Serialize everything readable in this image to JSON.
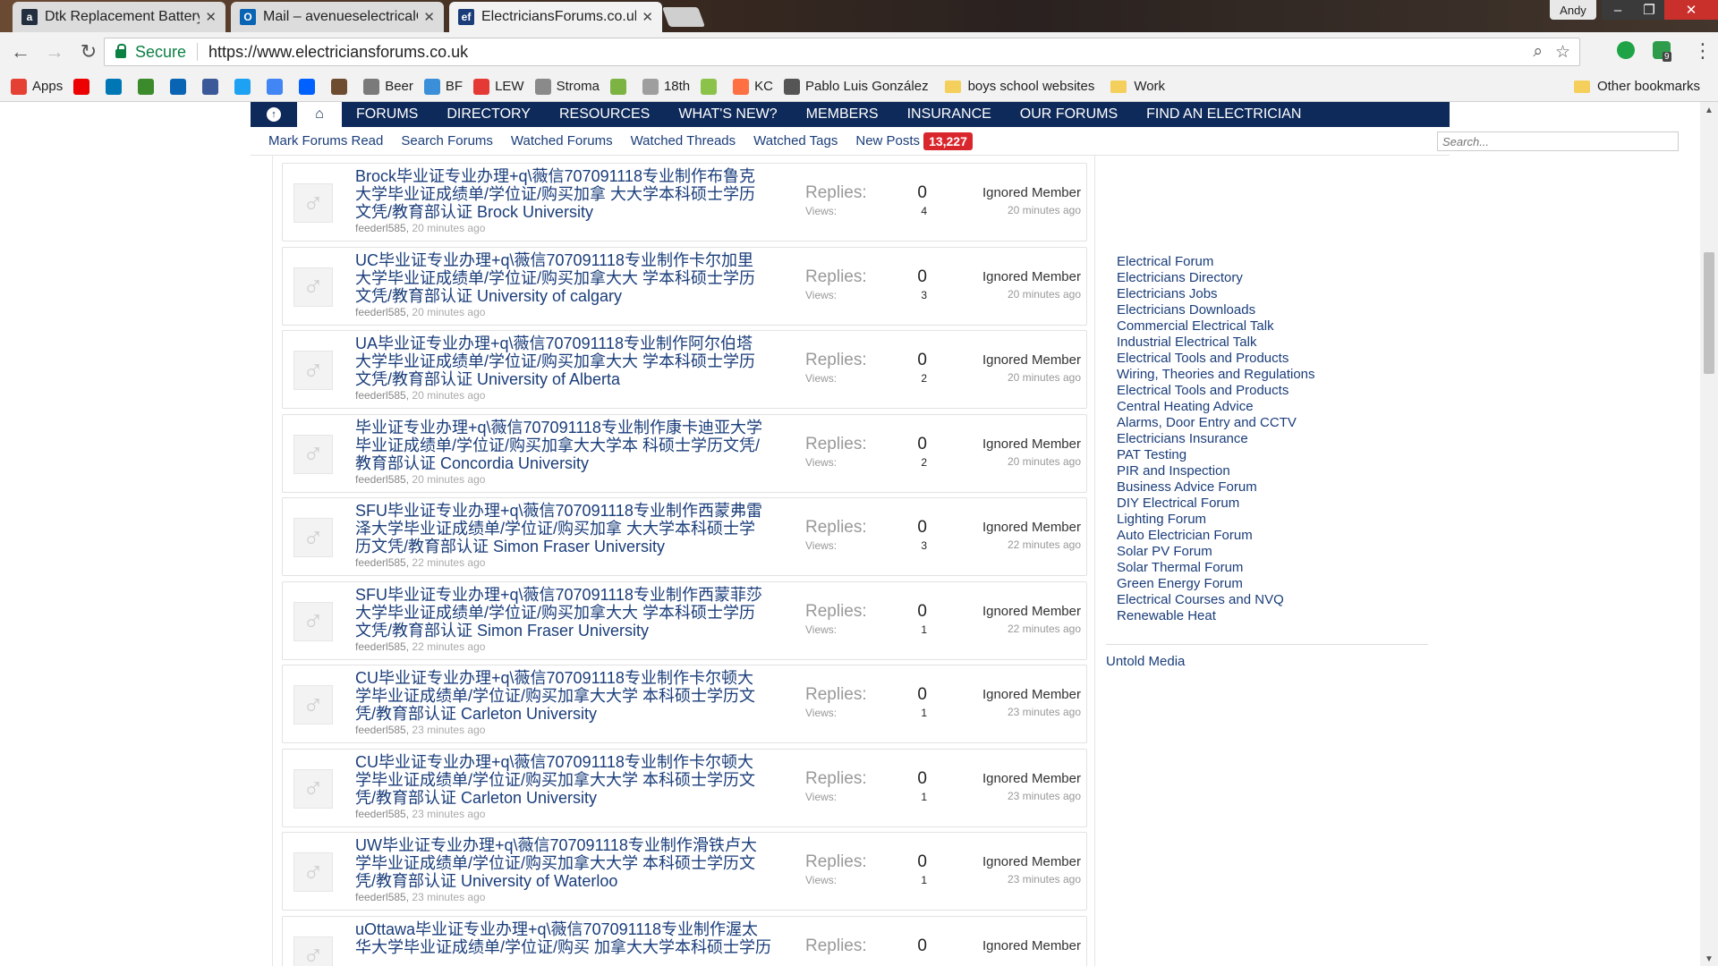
{
  "browser": {
    "tabs": [
      {
        "title": "Dtk Replacement Battery",
        "favicon": "a",
        "favicon_color": "#232f3e"
      },
      {
        "title": "Mail – avenueselectricalC",
        "favicon": "O",
        "favicon_color": "#0a64b4"
      },
      {
        "title": "ElectriciansForums.co.uk",
        "favicon": "ef",
        "favicon_color": "#1a3d7a"
      }
    ],
    "profile_name": "Andy",
    "secure_label": "Secure",
    "url": "https://www.electriciansforums.co.uk",
    "extension_badge": "9",
    "bookmarks": [
      {
        "label": "Apps",
        "icon": "apps-grid-icon",
        "color": "#e44134"
      },
      {
        "label": "",
        "icon": "santander-icon",
        "color": "#ec0000"
      },
      {
        "label": "",
        "icon": "linkedin-icon",
        "color": "#0077b5"
      },
      {
        "label": "",
        "icon": "fh-icon",
        "color": "#3b8b2c"
      },
      {
        "label": "",
        "icon": "outlook-icon",
        "color": "#0a64b4"
      },
      {
        "label": "",
        "icon": "facebook-icon",
        "color": "#3b5998"
      },
      {
        "label": "",
        "icon": "twitter-icon",
        "color": "#1da1f2"
      },
      {
        "label": "",
        "icon": "google-icon",
        "color": "#4285f4"
      },
      {
        "label": "",
        "icon": "dropbox-icon",
        "color": "#0061ff"
      },
      {
        "label": "",
        "icon": "wallet-icon",
        "color": "#6d4c2f"
      },
      {
        "label": "Beer",
        "icon": "beer-icon",
        "color": "#7a7a7a"
      },
      {
        "label": "BF",
        "icon": "bf-icon",
        "color": "#3a8fd8"
      },
      {
        "label": "LEW",
        "icon": "lew-icon",
        "color": "#e53935"
      },
      {
        "label": "Stroma",
        "icon": "stroma-icon",
        "color": "#8a8a8a"
      },
      {
        "label": "",
        "icon": "globe-icon",
        "color": "#7cb342"
      },
      {
        "label": "18th",
        "icon": "document-icon",
        "color": "#9e9e9e"
      },
      {
        "label": "",
        "icon": "bitcoin-icon",
        "color": "#8bc34a"
      },
      {
        "label": "KC",
        "icon": "kc-icon",
        "color": "#ff7043"
      },
      {
        "label": "Pablo Luis González",
        "icon": "person-icon",
        "color": "#555555"
      },
      {
        "label": "boys school websites",
        "icon": "folder-icon",
        "color": "#f4cf5b"
      },
      {
        "label": "Work",
        "icon": "folder-icon",
        "color": "#f4cf5b"
      }
    ],
    "other_bookmarks": "Other bookmarks"
  },
  "site": {
    "nav": [
      "FORUMS",
      "DIRECTORY",
      "RESOURCES",
      "WHAT'S NEW?",
      "MEMBERS",
      "INSURANCE",
      "OUR FORUMS",
      "FIND AN ELECTRICIAN"
    ],
    "subnav": [
      "Mark Forums Read",
      "Search Forums",
      "Watched Forums",
      "Watched Threads",
      "Watched Tags",
      "New Posts"
    ],
    "new_posts_count": "13,227",
    "search_placeholder": "Search...",
    "colors": {
      "nav_bg": "#0e2a5a",
      "link": "#1a3d7a",
      "badge": "#d9262c"
    }
  },
  "threads": [
    {
      "title": "Brock毕业证专业办理+q\\薇信707091118专业制作布鲁克\n大学毕业证成绩单/学位证/购买加拿 大大学本科硕士学历\n文凭/教育部认证 Brock University",
      "author": "feederl585",
      "time": "20 minutes ago",
      "replies_label": "Replies:",
      "replies": "0",
      "views_label": "Views:",
      "views": "4",
      "last_user": "Ignored Member",
      "last_time": "20 minutes ago"
    },
    {
      "title": "UC毕业证专业办理+q\\薇信707091118专业制作卡尔加里\n大学毕业证成绩单/学位证/购买加拿大大 学本科硕士学历\n文凭/教育部认证 University of calgary",
      "author": "feederl585",
      "time": "20 minutes ago",
      "replies_label": "Replies:",
      "replies": "0",
      "views_label": "Views:",
      "views": "3",
      "last_user": "Ignored Member",
      "last_time": "20 minutes ago"
    },
    {
      "title": "UA毕业证专业办理+q\\薇信707091118专业制作阿尔伯塔\n大学毕业证成绩单/学位证/购买加拿大大 学本科硕士学历\n文凭/教育部认证 University of Alberta",
      "author": "feederl585",
      "time": "20 minutes ago",
      "replies_label": "Replies:",
      "replies": "0",
      "views_label": "Views:",
      "views": "2",
      "last_user": "Ignored Member",
      "last_time": "20 minutes ago"
    },
    {
      "title": "毕业证专业办理+q\\薇信707091118专业制作康卡迪亚大学\n毕业证成绩单/学位证/购买加拿大大学本 科硕士学历文凭/\n教育部认证 Concordia University",
      "author": "feederl585",
      "time": "20 minutes ago",
      "replies_label": "Replies:",
      "replies": "0",
      "views_label": "Views:",
      "views": "2",
      "last_user": "Ignored Member",
      "last_time": "20 minutes ago"
    },
    {
      "title": "SFU毕业证专业办理+q\\薇信707091118专业制作西蒙弗雷\n泽大学毕业证成绩单/学位证/购买加拿 大大学本科硕士学\n历文凭/教育部认证 Simon Fraser University",
      "author": "feederl585",
      "time": "22 minutes ago",
      "replies_label": "Replies:",
      "replies": "0",
      "views_label": "Views:",
      "views": "3",
      "last_user": "Ignored Member",
      "last_time": "22 minutes ago"
    },
    {
      "title": "SFU毕业证专业办理+q\\薇信707091118专业制作西蒙菲莎\n大学毕业证成绩单/学位证/购买加拿大大 学本科硕士学历\n文凭/教育部认证 Simon Fraser University",
      "author": "feederl585",
      "time": "22 minutes ago",
      "replies_label": "Replies:",
      "replies": "0",
      "views_label": "Views:",
      "views": "1",
      "last_user": "Ignored Member",
      "last_time": "22 minutes ago"
    },
    {
      "title": "CU毕业证专业办理+q\\薇信707091118专业制作卡尔顿大\n学毕业证成绩单/学位证/购买加拿大大学 本科硕士学历文\n凭/教育部认证 Carleton University",
      "author": "feederl585",
      "time": "23 minutes ago",
      "replies_label": "Replies:",
      "replies": "0",
      "views_label": "Views:",
      "views": "1",
      "last_user": "Ignored Member",
      "last_time": "23 minutes ago"
    },
    {
      "title": "CU毕业证专业办理+q\\薇信707091118专业制作卡尔顿大\n学毕业证成绩单/学位证/购买加拿大大学 本科硕士学历文\n凭/教育部认证 Carleton University",
      "author": "feederl585",
      "time": "23 minutes ago",
      "replies_label": "Replies:",
      "replies": "0",
      "views_label": "Views:",
      "views": "1",
      "last_user": "Ignored Member",
      "last_time": "23 minutes ago"
    },
    {
      "title": "UW毕业证专业办理+q\\薇信707091118专业制作滑铁卢大\n学毕业证成绩单/学位证/购买加拿大大学 本科硕士学历文\n凭/教育部认证 University of Waterloo",
      "author": "feederl585",
      "time": "23 minutes ago",
      "replies_label": "Replies:",
      "replies": "0",
      "views_label": "Views:",
      "views": "1",
      "last_user": "Ignored Member",
      "last_time": "23 minutes ago"
    },
    {
      "title": "uOttawa毕业证专业办理+q\\薇信707091118专业制作渥太\n华大学毕业证成绩单/学位证/购买 加拿大大学本科硕士学历",
      "author": "",
      "time": "",
      "replies_label": "Replies:",
      "replies": "0",
      "views_label": "",
      "views": "",
      "last_user": "Ignored Member",
      "last_time": ""
    }
  ],
  "sidebar": {
    "links": [
      "Electrical Forum",
      "Electricians Directory",
      "Electricians Jobs",
      "Electricians Downloads",
      "Commercial Electrical Talk",
      "Industrial Electrical Talk",
      "Electrical Tools and Products",
      "Wiring, Theories and Regulations",
      "Electrical Tools and Products",
      "Central Heating Advice",
      "Alarms, Door Entry and CCTV",
      "Electricians Insurance",
      "PAT Testing",
      "PIR and Inspection",
      "Business Advice Forum",
      "DIY Electrical Forum",
      "Lighting Forum",
      "Auto Electrician Forum",
      "Solar PV Forum",
      "Solar Thermal Forum",
      "Green Energy Forum",
      "Electrical Courses and NVQ",
      "Renewable Heat"
    ],
    "footer": "Untold Media"
  }
}
